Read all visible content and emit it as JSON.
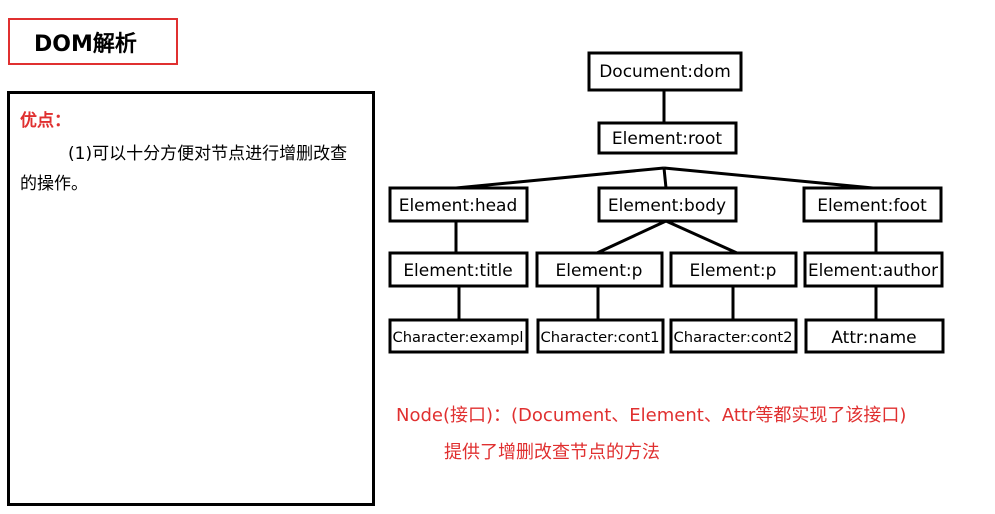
{
  "title": "DOM解析",
  "pros": {
    "label": "优点：",
    "text": "(1)可以十分方便对节点进行增删改查的操作。"
  },
  "tree": {
    "nodes": {
      "document": "Document:dom",
      "root": "Element:root",
      "head": "Element:head",
      "body": "Element:body",
      "foot": "Element:foot",
      "title": "Element:title",
      "p1": "Element:p",
      "p2": "Element:p",
      "author": "Element:author",
      "char_example": "Character:exampl",
      "char_cont1": "Character:cont1",
      "char_cont2": "Character:cont2",
      "attr_name": "Attr:name"
    }
  },
  "notes": {
    "line1": "Node(接口)：(Document、Element、Attr等都实现了该接口)",
    "line2": "提供了增删改查节点的方法"
  }
}
